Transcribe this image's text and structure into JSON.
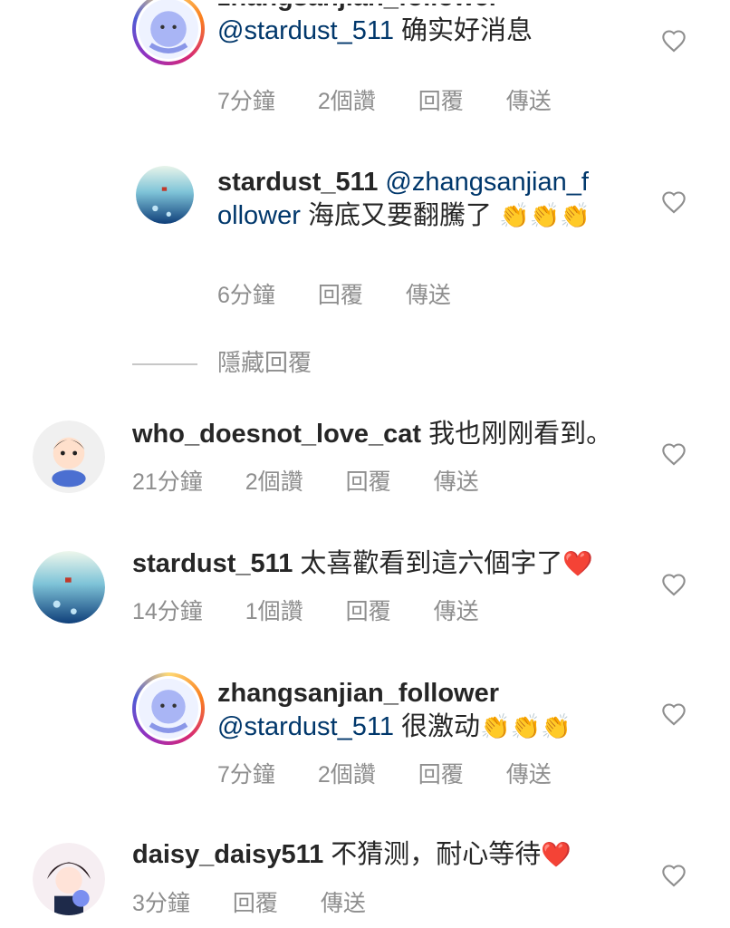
{
  "comments": [
    {
      "username": "zhangsanjian_follower",
      "mention": "@stardust_511",
      "text": "确实好消息",
      "time": "7分鐘",
      "likes": "2個讚",
      "reply": "回覆",
      "send": "傳送"
    },
    {
      "username": "stardust_511",
      "mention": "@zhangsanjian_follower",
      "text": "海底又要翻騰了",
      "emoji": "👏👏👏",
      "time": "6分鐘",
      "reply": "回覆",
      "send": "傳送"
    },
    {
      "username": "who_doesnot_love_cat",
      "text": "我也刚刚看到。",
      "time": "21分鐘",
      "likes": "2個讚",
      "reply": "回覆",
      "send": "傳送"
    },
    {
      "username": "stardust_511",
      "text": "太喜歡看到這六個字了",
      "emoji": "❤️",
      "time": "14分鐘",
      "likes": "1個讚",
      "reply": "回覆",
      "send": "傳送"
    },
    {
      "username": "zhangsanjian_follower",
      "mention": "@stardust_511",
      "text": "很激动",
      "emoji": "👏👏👏",
      "time": "7分鐘",
      "likes": "2個讚",
      "reply": "回覆",
      "send": "傳送"
    },
    {
      "username": "daisy_daisy511",
      "text": "不猜测，耐心等待",
      "emoji": "❤️",
      "time": "3分鐘",
      "reply": "回覆",
      "send": "傳送"
    }
  ],
  "hide_replies": "隱藏回覆",
  "colors": {
    "username": "#262626",
    "mention": "#00376b",
    "meta": "#8e8e8e",
    "heart_outline": "#8e8e8e",
    "heart_filled": "#ed4956"
  },
  "icons": {
    "like": "heart-outline-icon"
  }
}
